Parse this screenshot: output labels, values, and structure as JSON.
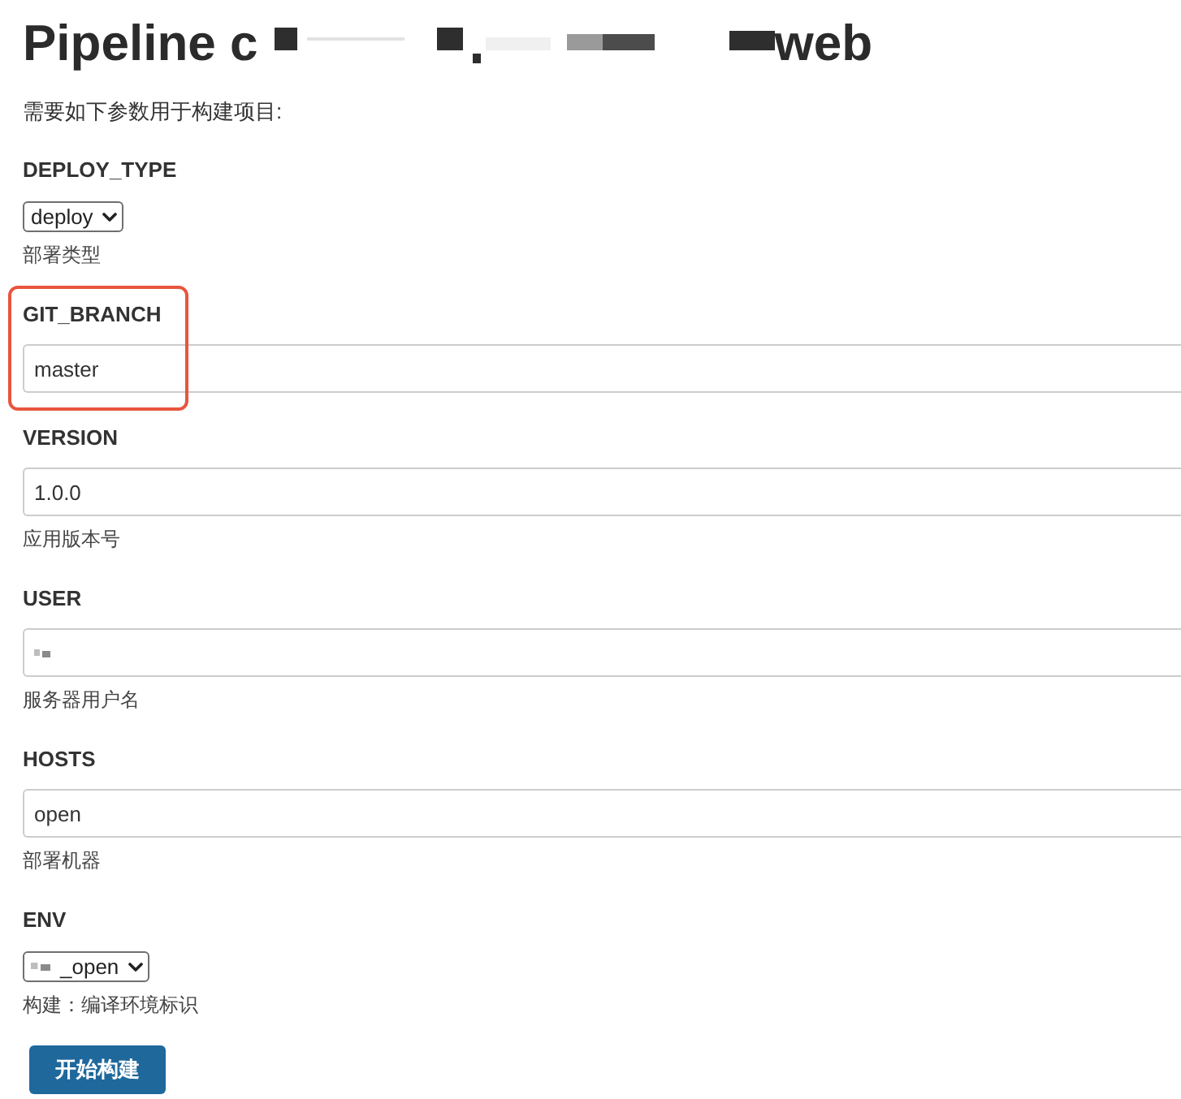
{
  "page": {
    "title_start": "Pipeline c",
    "title_end": "web",
    "title_redacted": true,
    "intro": "需要如下参数用于构建项目:"
  },
  "parameters": [
    {
      "kind": "select",
      "name": "DEPLOY_TYPE",
      "value": "deploy",
      "description": "部署类型",
      "highlighted": false,
      "redacted": false
    },
    {
      "kind": "text",
      "name": "GIT_BRANCH",
      "value": "master",
      "highlighted": true,
      "redacted": false
    },
    {
      "kind": "text",
      "name": "VERSION",
      "value": "1.0.0",
      "description": "应用版本号",
      "highlighted": false,
      "redacted": false
    },
    {
      "kind": "text",
      "name": "USER",
      "description": "服务器用户名",
      "highlighted": false,
      "redacted": true
    },
    {
      "kind": "text",
      "name": "HOSTS",
      "value": "open",
      "description": "部署机器",
      "highlighted": false,
      "redacted": false
    },
    {
      "kind": "select",
      "name": "ENV",
      "value": "_open",
      "description": "构建：编译环境标识",
      "highlighted": false,
      "redacted": true
    }
  ],
  "build_button": "开始构建"
}
